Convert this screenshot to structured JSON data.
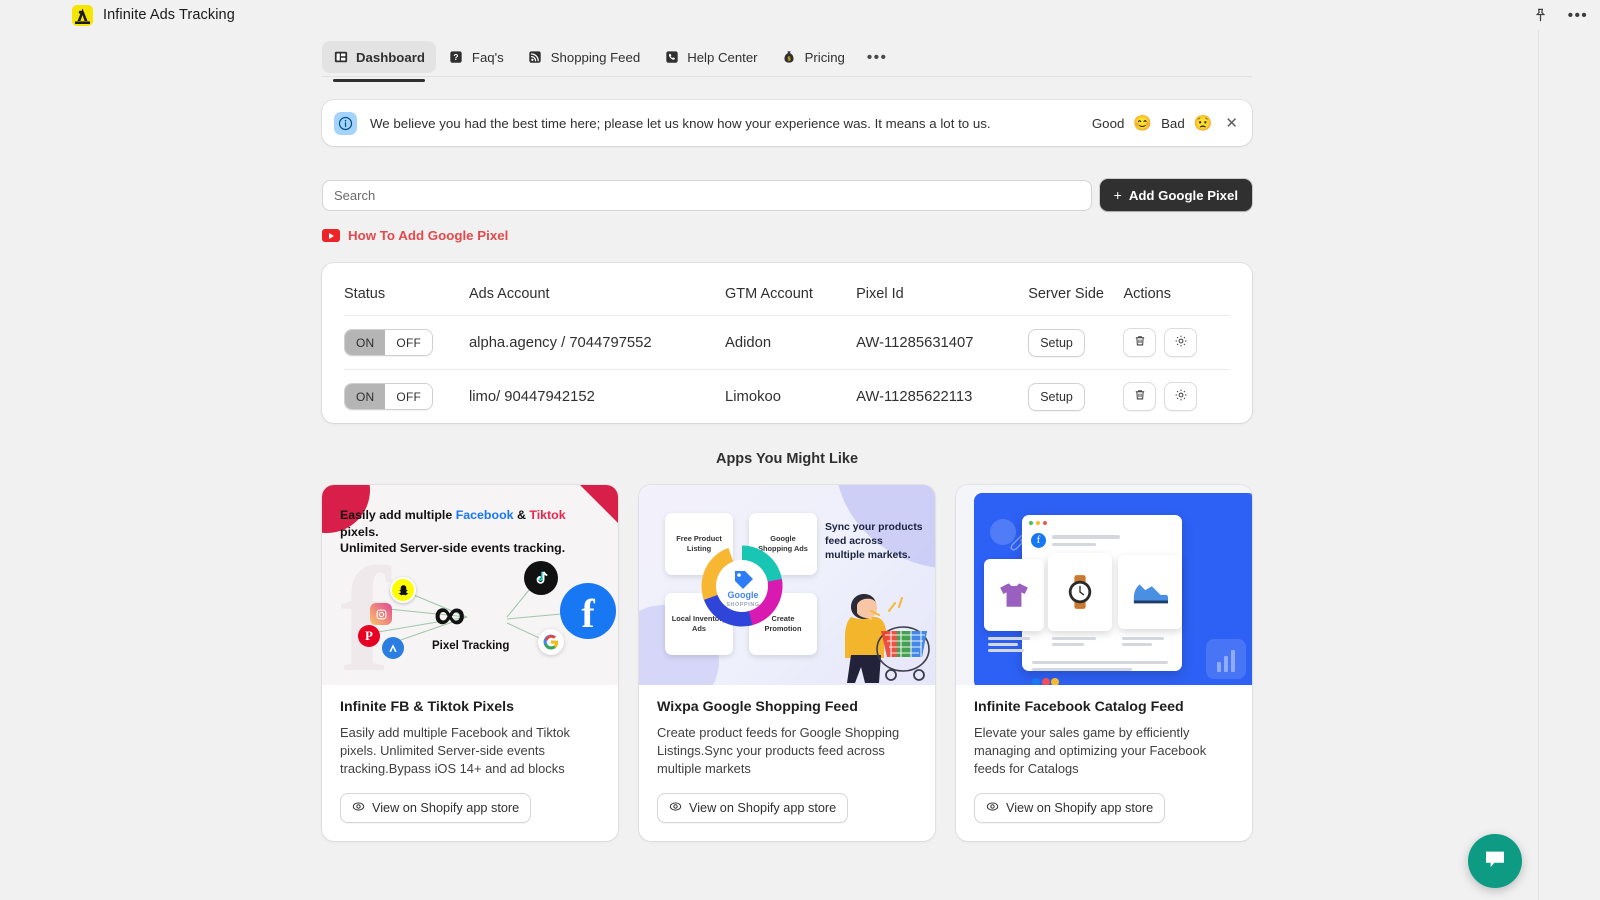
{
  "header": {
    "app_title": "Infinite Ads Tracking",
    "logo_icon": "infinite-ads-logo",
    "pin_icon": "pin-icon",
    "more_icon": "more-horizontal-icon"
  },
  "tabs": [
    {
      "label": "Dashboard",
      "icon": "dashboard-icon",
      "active": true
    },
    {
      "label": "Faq's",
      "icon": "question-mark-icon",
      "active": false
    },
    {
      "label": "Shopping Feed",
      "icon": "rss-feed-icon",
      "active": false
    },
    {
      "label": "Help Center",
      "icon": "phone-icon",
      "active": false
    },
    {
      "label": "Pricing",
      "icon": "money-bag-icon",
      "active": false
    }
  ],
  "tabs_more_label": "•••",
  "banner": {
    "icon": "info-circle-icon",
    "message": "We believe you had the best time here; please let us know how your experience was. It means a lot to us.",
    "good_label": "Good",
    "good_emoji": "😊",
    "bad_label": "Bad",
    "bad_emoji": "😟",
    "close_label": "✕"
  },
  "search": {
    "placeholder": "Search",
    "value": ""
  },
  "add_pixel_button": {
    "plus": "+",
    "label": "Add Google Pixel"
  },
  "how_to_link": {
    "label": "How To Add Google Pixel",
    "icon": "youtube-play-icon",
    "color": "#e5484d"
  },
  "table": {
    "columns": [
      "Status",
      "Ads Account",
      "GTM Account",
      "Pixel Id",
      "Server Side",
      "Actions"
    ],
    "toggle": {
      "on_label": "ON",
      "off_label": "OFF"
    },
    "setup_label": "Setup",
    "delete_icon": "trash-icon",
    "settings_icon": "gear-icon",
    "rows": [
      {
        "status": "ON",
        "ads_account": "alpha.agency / 7044797552",
        "gtm_account": "Adidon",
        "pixel_id": "AW-11285631407",
        "server_side": "Setup"
      },
      {
        "status": "ON",
        "ads_account": "limo/ 90447942152",
        "gtm_account": "Limokoo",
        "pixel_id": "AW-11285622113",
        "server_side": "Setup"
      }
    ]
  },
  "apps_section": {
    "title": "Apps You Might Like",
    "cards": [
      {
        "name": "Infinite FB & Tiktok Pixels",
        "description": "Easily add multiple Facebook and Tiktok pixels. Unlimited Server-side events tracking.Bypass iOS 14+ and ad blocks",
        "button_label": "View on Shopify app store",
        "button_icon": "eye-icon",
        "thumb": {
          "headline_1": "Easily add multiple ",
          "headline_fb": "Facebook",
          "headline_amp": " & ",
          "headline_tk": "Tiktok",
          "headline_2": " pixels.",
          "headline_3": "Unlimited Server-side events tracking.",
          "center_label": "Pixel Tracking"
        }
      },
      {
        "name": "Wixpa Google Shopping Feed",
        "description": "Create product feeds for Google Shopping Listings.Sync your products feed across multiple markets",
        "button_label": "View on Shopify app store",
        "button_icon": "eye-icon",
        "thumb": {
          "tile_1": "Free Product Listing",
          "tile_2": "Google Shopping Ads",
          "tile_3": "Local Inventory Ads",
          "tile_4": "Create Promotion",
          "center_label": "Google",
          "center_sub": "SHOPPING",
          "side_text": "Sync your products feed across multiple markets."
        }
      },
      {
        "name": "Infinite Facebook Catalog Feed",
        "description": "Elevate your sales game by efficiently managing and optimizing your Facebook feeds for Catalogs",
        "button_label": "View on Shopify app store",
        "button_icon": "eye-icon",
        "thumb": {
          "brand_icon": "facebook-icon"
        }
      }
    ]
  },
  "chat_widget": {
    "icon": "chat-bubble-icon",
    "color": "#0e9b84"
  }
}
